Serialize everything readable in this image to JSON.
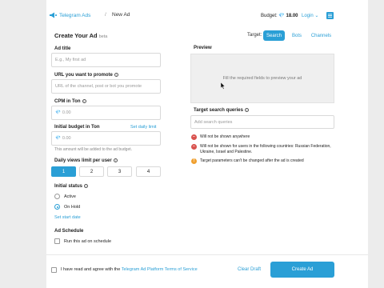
{
  "header": {
    "brand": "Telegram Ads",
    "separator": "/",
    "breadcrumb": "New Ad",
    "budget_label": "Budget:",
    "budget_value": "💎 18.00",
    "login": "Login"
  },
  "form": {
    "title": "Create Your Ad",
    "beta": "beta",
    "target_label": "Target:",
    "target_tabs": [
      "Search",
      "Bots",
      "Channels"
    ],
    "ad_title_label": "Ad title",
    "ad_title_placeholder": "E.g., My first ad",
    "url_label": "URL you want to promote",
    "url_placeholder": "URL of the channel, post or bot you promote",
    "cpm_label": "CPM in Ton",
    "cpm_placeholder": "0.00",
    "budget_label": "Initial budget in Ton",
    "budget_link": "Set daily limit",
    "budget_placeholder": "0.00",
    "budget_hint": "This amount will be added to the ad budget.",
    "daily_views_label": "Daily views limit per user",
    "daily_views_options": [
      "1",
      "2",
      "3",
      "4"
    ],
    "status_label": "Initial status",
    "status_options": [
      "Active",
      "On Hold"
    ],
    "start_date_link": "Set start date",
    "schedule_label": "Ad Schedule",
    "schedule_checkbox": "Run this ad on schedule"
  },
  "preview": {
    "label": "Preview",
    "placeholder": "Fill the required fields to preview your ad",
    "queries_label": "Target search queries",
    "queries_placeholder": "Add search queries",
    "warnings": [
      "Will not be shown anywhere",
      "Will not be shown for users in the following countries: Russian Federation, Ukraine, Israel and Palestine.",
      "Target parameters can't be changed after the ad is created"
    ]
  },
  "footer": {
    "agree_prefix": "I have read and agree with the",
    "agree_link": "Telegram Ad Platform Terms of Service",
    "clear_draft": "Clear Draft",
    "create_ad": "Create Ad"
  },
  "colors": {
    "accent": "#2a9fd6",
    "warning_red": "#d9534f",
    "warning_orange": "#f0a030"
  }
}
